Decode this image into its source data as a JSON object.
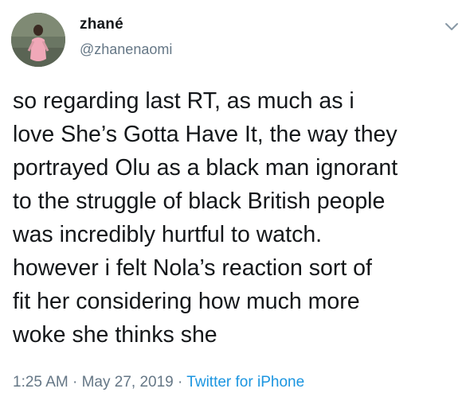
{
  "tweet": {
    "display_name": "zhané",
    "handle": "@zhanenaomi",
    "text": "so regarding last RT, as much as i\nlove She’s Gotta Have It, the way they\nportrayed Olu as a black man ignorant\nto the struggle of black British people\nwas incredibly hurtful to watch.\nhowever i felt Nola’s reaction sort of\nfit her considering how much more\nwoke she thinks she",
    "time": "1:25 AM",
    "date": "May 27, 2019",
    "source": "Twitter for iPhone",
    "separator": " · "
  },
  "icons": {
    "avatar": "profile-photo",
    "menu": "chevron-down-icon"
  },
  "colors": {
    "text": "#14171a",
    "secondary": "#657786",
    "link": "#1b95e0"
  }
}
